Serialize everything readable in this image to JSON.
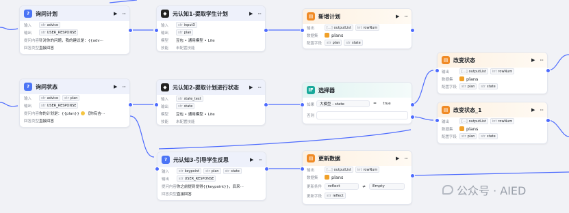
{
  "labels": {
    "input": "输入",
    "output": "输出",
    "question": "提问内容",
    "answer_type": "回答类型",
    "model": "模型",
    "skill": "技能",
    "dataset": "数据集",
    "config": "配置字段",
    "if": "如果",
    "else": "否则",
    "update_condition": "更新条件",
    "update_field": "更新字段"
  },
  "nodes": {
    "ask_plan": {
      "title": "询问计划",
      "input": [
        {
          "type": "str",
          "name": "advice"
        }
      ],
      "output": [
        {
          "type": "str",
          "name": "USER_RESPONSE"
        }
      ],
      "question": "针对你的问题，我的建议是：{{adv···",
      "answer_type": "直接回答"
    },
    "meta1": {
      "title": "元认知1-提取学生计划",
      "input": [
        {
          "type": "str",
          "name": "input3"
        }
      ],
      "output": [
        {
          "type": "str",
          "name": "plan"
        }
      ],
      "model": "豆包 • 通用模型 • Lite",
      "skill": "未配置技能"
    },
    "add_plan": {
      "title": "新增计划",
      "output": [
        {
          "type": "[...]",
          "name": "outputList"
        },
        {
          "type": "int",
          "name": "rowNum"
        }
      ],
      "dataset": "plans",
      "config": [
        {
          "type": "str",
          "name": "plan"
        },
        {
          "type": "str",
          "name": "state"
        }
      ]
    },
    "change_state": {
      "title": "改变状态",
      "output": [
        {
          "type": "[...]",
          "name": "outputList"
        },
        {
          "type": "int",
          "name": "rowNum"
        }
      ],
      "dataset": "plans",
      "config": [
        {
          "type": "str",
          "name": "plan"
        },
        {
          "type": "str",
          "name": "state"
        }
      ]
    },
    "ask_state": {
      "title": "询问状态",
      "input": [
        {
          "type": "str",
          "name": "advice"
        },
        {
          "type": "str",
          "name": "plan"
        }
      ],
      "output": [
        {
          "type": "str",
          "name": "USER_RESPONSE"
        }
      ],
      "question_a": "你的计划是：{{plan}}",
      "question_b": "【你有吉···",
      "answer_type": "直接回答"
    },
    "meta2": {
      "title": "元认知2-提取计划进行状态",
      "input": [
        {
          "type": "str",
          "name": "state_text"
        }
      ],
      "output": [
        {
          "type": "str",
          "name": "state"
        }
      ],
      "model": "豆包 • 通用模型 • Lite",
      "skill": "未配置技能"
    },
    "selector": {
      "title": "选择器",
      "left": "大模型 - state",
      "operator": "=",
      "right": "true"
    },
    "change_state_1": {
      "title": "改变状态_1",
      "output": [
        {
          "type": "[...]",
          "name": "outputList"
        },
        {
          "type": "int",
          "name": "rowNum"
        }
      ],
      "dataset": "plans",
      "config": [
        {
          "type": "str",
          "name": "plan"
        },
        {
          "type": "str",
          "name": "state"
        }
      ]
    },
    "meta3": {
      "title": "元认知3-引导学生反思",
      "input": [
        {
          "type": "str",
          "name": "keypoint"
        },
        {
          "type": "str",
          "name": "plan"
        },
        {
          "type": "str",
          "name": "state"
        }
      ],
      "output": [
        {
          "type": "str",
          "name": "USER_RESPONSE"
        }
      ],
      "question": "你之前提到觉得{{keypoint}}，后来···",
      "answer_type": "直接回答"
    },
    "update_data": {
      "title": "更新数据",
      "output": [
        {
          "type": "[...]",
          "name": "outputList"
        },
        {
          "type": "int",
          "name": "rowNum"
        }
      ],
      "dataset": "plans",
      "cond_left": "reflect",
      "cond_op": "≠",
      "cond_right": "Empty",
      "field": [
        {
          "type": "str",
          "name": "reflect"
        }
      ]
    }
  },
  "watermark": "公众号 · AIED",
  "colors": {
    "edge": "#4d6bfe",
    "llm_icon": "#222222",
    "ask_icon": "#4b74f5",
    "code_icon": "#f08a24",
    "cond_icon": "#18a99a"
  }
}
